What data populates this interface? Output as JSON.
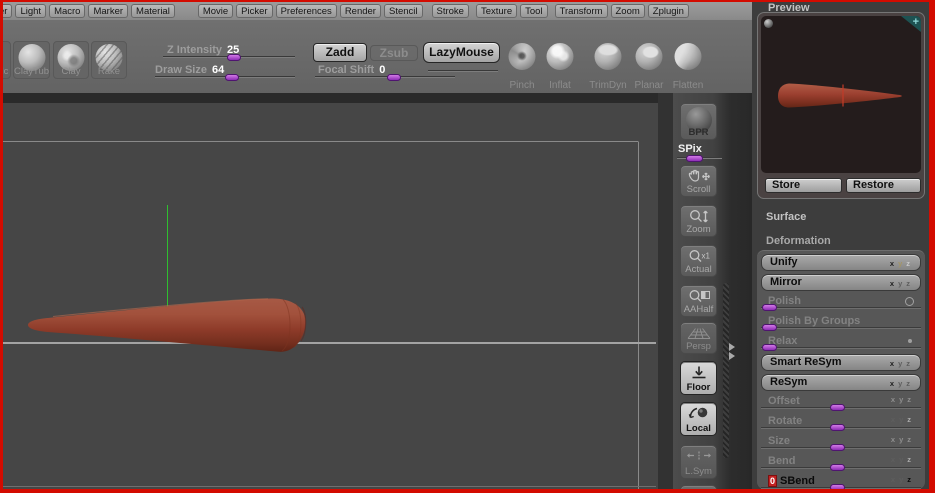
{
  "menu": {
    "items": [
      "er",
      "Light",
      "Macro",
      "Marker",
      "Material",
      "Movie",
      "Picker",
      "Preferences",
      "Render",
      "Stencil",
      "Stroke",
      "Texture",
      "Tool",
      "Transform",
      "Zoom",
      "Zplugin"
    ]
  },
  "toolbar": {
    "brushes_left": [
      {
        "label": "lc",
        "partial": true
      },
      {
        "label": "ClayTube"
      },
      {
        "label": "Clay"
      },
      {
        "label": "Rake"
      }
    ],
    "z_intensity_label": "Z Intensity",
    "z_intensity_value": "25",
    "draw_size_label": "Draw Size",
    "draw_size_value": "64",
    "focal_shift_label": "Focal Shift",
    "focal_shift_value": "0",
    "zadd_label": "Zadd",
    "zsub_label": "Zsub",
    "lazymouse_label": "LazyMouse",
    "brushes_right": [
      "Pinch",
      "Inflat",
      "TrimDyn",
      "Planar",
      "Flatten"
    ]
  },
  "side_toolbar": {
    "bpr_label": "BPR",
    "spix_label": "SPix",
    "buttons": [
      {
        "label": "Scroll",
        "icon": "scroll",
        "state": "normal"
      },
      {
        "label": "Zoom",
        "icon": "zoom",
        "state": "normal"
      },
      {
        "label": "Actual",
        "icon": "actual",
        "state": "normal"
      },
      {
        "label": "AAHalf",
        "icon": "aahalf",
        "state": "normal"
      },
      {
        "label": "Persp",
        "icon": "persp",
        "state": "dim"
      },
      {
        "label": "Floor",
        "icon": "floor",
        "state": "active"
      },
      {
        "label": "Local",
        "icon": "local",
        "state": "active"
      },
      {
        "label": "L.Sym",
        "icon": "lsym",
        "state": "dim"
      }
    ]
  },
  "right_panel": {
    "preview_title": "Preview",
    "plus": "+",
    "store_label": "Store",
    "restore_label": "Restore",
    "surface_label": "Surface",
    "deformation_title": "Deformation",
    "rows": [
      {
        "type": "button",
        "label": "Unify",
        "axes": [
          [
            "x",
            "dark"
          ],
          [
            "y",
            "tan"
          ],
          [
            "z",
            "lite"
          ]
        ]
      },
      {
        "type": "button",
        "label": "Mirror",
        "axes": [
          [
            "x",
            "dark"
          ],
          [
            "y",
            "dim"
          ],
          [
            "z",
            "dim"
          ]
        ]
      },
      {
        "type": "slider",
        "label": "Polish",
        "pos": 0,
        "right": "ring"
      },
      {
        "type": "slider",
        "label": "Polish By Groups",
        "pos": 0
      },
      {
        "type": "slider",
        "label": "Relax",
        "pos": 0,
        "right": "dot"
      },
      {
        "type": "button",
        "label": "Smart ReSym",
        "axes": [
          [
            "x",
            "dark"
          ],
          [
            "y",
            "dim"
          ],
          [
            "z",
            "dim"
          ]
        ]
      },
      {
        "type": "button",
        "label": "ReSym",
        "axes": [
          [
            "x",
            "dark"
          ],
          [
            "y",
            "dim"
          ],
          [
            "z",
            "dim"
          ]
        ]
      },
      {
        "type": "slider",
        "label": "Offset",
        "pos": 0.5,
        "axes": [
          [
            "x",
            "mid"
          ],
          [
            "y",
            "mid"
          ],
          [
            "z",
            "mid"
          ]
        ]
      },
      {
        "type": "slider",
        "label": "Rotate",
        "pos": 0.5,
        "axes": [
          [
            "x",
            "dim"
          ],
          [
            "y",
            "dim"
          ],
          [
            "z",
            "mid2"
          ]
        ]
      },
      {
        "type": "slider",
        "label": "Size",
        "pos": 0.5,
        "axes": [
          [
            "x",
            "mid"
          ],
          [
            "y",
            "mid"
          ],
          [
            "z",
            "mid"
          ]
        ]
      },
      {
        "type": "slider",
        "label": "Bend",
        "pos": 0.5,
        "axes": [
          [
            "x",
            "dim"
          ],
          [
            "y",
            "dim"
          ],
          [
            "z",
            "mid2"
          ]
        ]
      },
      {
        "type": "slider",
        "label": "SBend",
        "pos": 0.5,
        "badge": "0",
        "hot": true,
        "axes": [
          [
            "x",
            "dim"
          ],
          [
            "y",
            "dim"
          ],
          [
            "z",
            "blk"
          ]
        ]
      }
    ]
  },
  "colors": {
    "accent_purple": "#a94fd4",
    "border_red": "#d30b00",
    "cone_body": "#993f2e",
    "green_line": "#2fbf2f",
    "teal_corner": "#1d5252"
  }
}
